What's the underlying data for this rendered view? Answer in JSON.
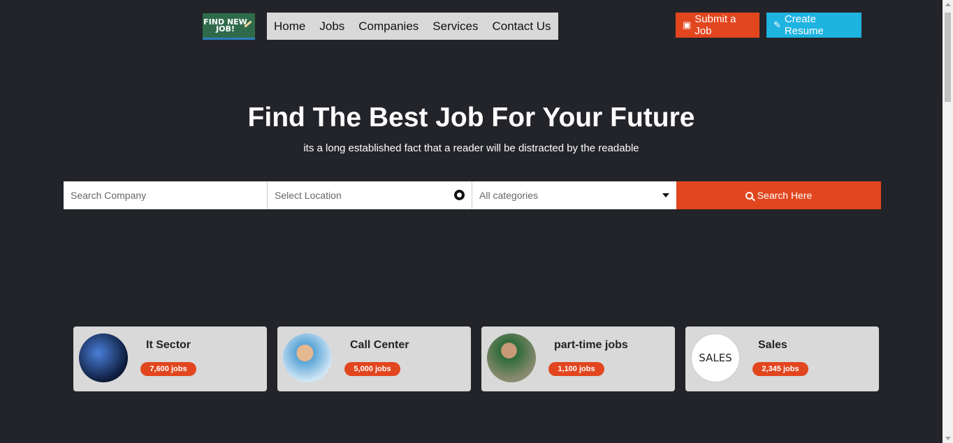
{
  "logo": {
    "text": "FIND NEW JOB!"
  },
  "nav": {
    "items": [
      "Home",
      "Jobs",
      "Companies",
      "Services",
      "Contact Us"
    ]
  },
  "buttons": {
    "submit_job": "Submit a Job",
    "create_resume": "Create Resume"
  },
  "hero": {
    "title": "Find The Best Job For Your Future",
    "subtitle": "its a long established fact that a reader will be distracted by the readable"
  },
  "search": {
    "company_placeholder": "Search Company",
    "location_placeholder": "Select Location",
    "category_selected": "All categories",
    "button_label": "Search Here"
  },
  "categories": [
    {
      "title": "It Sector",
      "jobs": "7,600 jobs"
    },
    {
      "title": "Call Center",
      "jobs": "5,000 jobs"
    },
    {
      "title": "part-time jobs",
      "jobs": "1,100 jobs"
    },
    {
      "title": "Sales",
      "jobs": "2,345 jobs"
    }
  ],
  "sales_image_text": "SALES",
  "colors": {
    "background": "#232429",
    "accent": "#e2461f",
    "info": "#1fb3e0",
    "card": "#d9d9d9"
  }
}
